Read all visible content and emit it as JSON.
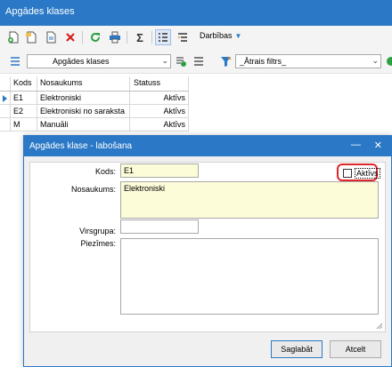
{
  "window": {
    "title": "Apgādes klases"
  },
  "toolbar": {
    "icons": [
      "new-doc-icon",
      "new-folder-icon",
      "copy-icon",
      "delete-icon",
      "refresh-icon",
      "print-icon",
      "sum-icon",
      "list-view-icon",
      "tree-view-icon",
      "indent-icon"
    ],
    "actions_label": "Darbības"
  },
  "filter": {
    "view_value": "Apgādes klases",
    "quick_filter_value": "_Ātrais filtrs_"
  },
  "grid": {
    "columns": [
      "Kods",
      "Nosaukums",
      "Statuss"
    ],
    "rows": [
      {
        "kods": "E1",
        "nosaukums": "Elektroniski",
        "statuss": "Aktīvs"
      },
      {
        "kods": "E2",
        "nosaukums": "Elektroniski no saraksta",
        "statuss": "Aktīvs"
      },
      {
        "kods": "M",
        "nosaukums": "Manuāli",
        "statuss": "Aktīvs"
      }
    ]
  },
  "dialog": {
    "title": "Apgādes klase - labošana",
    "labels": {
      "kods": "Kods:",
      "nosaukums": "Nosaukums:",
      "virsgrupa": "Virsgrupa:",
      "piezimes": "Piezīmes:"
    },
    "values": {
      "kods": "E1",
      "nosaukums": "Elektroniski",
      "virsgrupa": "",
      "piezimes": ""
    },
    "active_label": "Aktīvs",
    "active_checked": false,
    "save_label": "Saglabāt",
    "cancel_label": "Atcelt"
  },
  "colors": {
    "accent": "#2b79c6",
    "highlight_ring": "#e0262a",
    "required_field": "#fdfcd9"
  }
}
